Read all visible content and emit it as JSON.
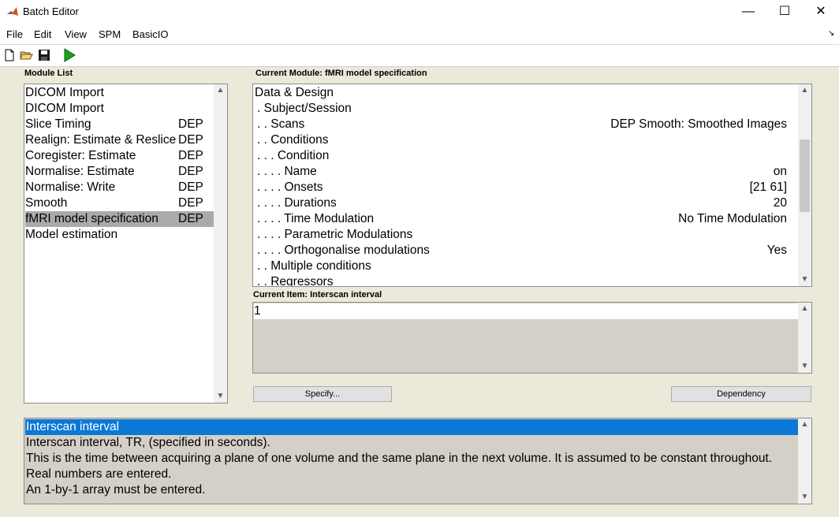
{
  "window": {
    "title": "Batch Editor",
    "minimize": "—",
    "maximize": "☐",
    "close": "✕"
  },
  "menu": {
    "items": [
      "File",
      "Edit",
      "View",
      "SPM",
      "BasicIO"
    ],
    "overflow": "↘"
  },
  "toolbar": {
    "icons": [
      "new-file-icon",
      "open-folder-icon",
      "save-icon",
      "run-icon"
    ],
    "run_color": "#1aa31a"
  },
  "module_list": {
    "label": "Module List",
    "items": [
      {
        "name": "DICOM Import",
        "dep": ""
      },
      {
        "name": "DICOM Import",
        "dep": ""
      },
      {
        "name": "Slice Timing",
        "dep": "DEP"
      },
      {
        "name": "Realign: Estimate & Reslice",
        "dep": "DEP"
      },
      {
        "name": "Coregister: Estimate",
        "dep": "DEP"
      },
      {
        "name": "Normalise: Estimate",
        "dep": "DEP"
      },
      {
        "name": "Normalise: Write",
        "dep": "DEP"
      },
      {
        "name": "Smooth",
        "dep": "DEP"
      },
      {
        "name": "fMRI model specification",
        "dep": "DEP"
      },
      {
        "name": "Model estimation",
        "dep": ""
      }
    ],
    "selected_index": 8
  },
  "current_module": {
    "label": "Current Module: fMRI model specification",
    "rows": [
      {
        "text": "Data & Design",
        "value": ""
      },
      {
        "text": ". Subject/Session",
        "value": ""
      },
      {
        "text": ". . Scans",
        "value": "DEP Smooth: Smoothed Images"
      },
      {
        "text": ". . Conditions",
        "value": ""
      },
      {
        "text": ". . . Condition",
        "value": ""
      },
      {
        "text": ". . . . Name",
        "value": "on"
      },
      {
        "text": ". . . . Onsets",
        "value": "[21 61]"
      },
      {
        "text": ". . . . Durations",
        "value": "20"
      },
      {
        "text": ". . . . Time Modulation",
        "value": "No Time Modulation"
      },
      {
        "text": ". . . . Parametric Modulations",
        "value": ""
      },
      {
        "text": ". . . . Orthogonalise modulations",
        "value": "Yes"
      },
      {
        "text": ". . Multiple conditions",
        "value": ""
      },
      {
        "text": ". . Regressors",
        "value": ""
      }
    ]
  },
  "current_item": {
    "label": "Current Item: Interscan interval",
    "value": "1"
  },
  "buttons": {
    "specify": "Specify...",
    "dependency": "Dependency"
  },
  "help": {
    "lines": [
      "Interscan interval",
      "Interscan interval, TR, (specified in seconds).",
      "This is the time between acquiring a plane of one volume and the same plane in the next volume.  It is assumed to be constant throughout.",
      "Real numbers are entered.",
      "An 1-by-1 array must be entered."
    ],
    "highlight_color": "#0a78d7"
  },
  "scroll": {
    "up": "▲",
    "down": "▼"
  }
}
